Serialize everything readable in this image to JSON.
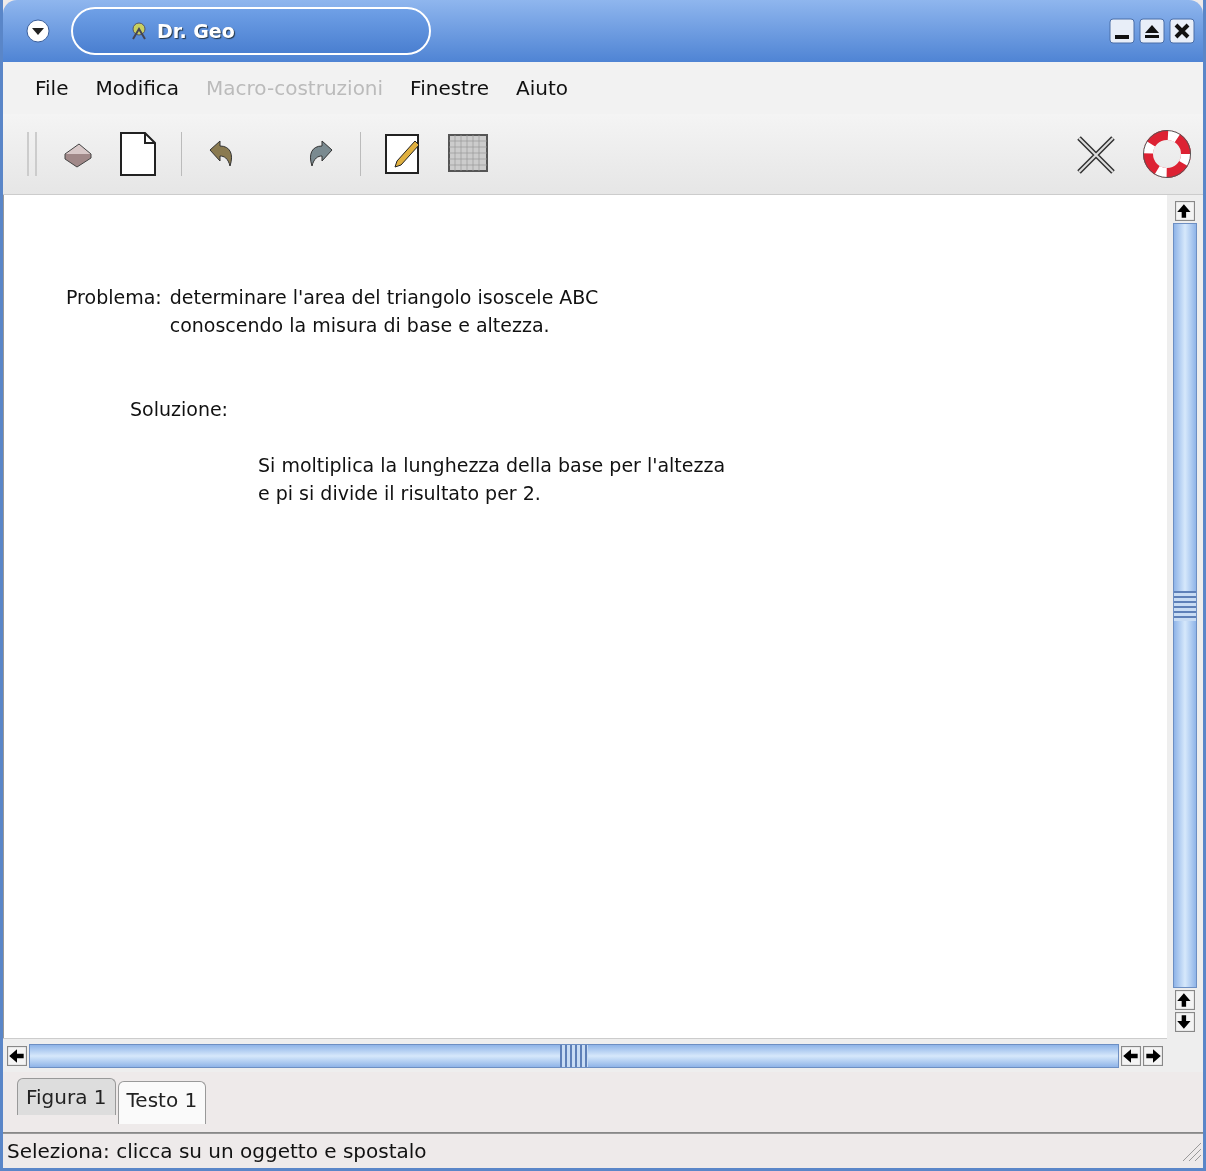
{
  "window": {
    "title": "Dr. Geo"
  },
  "menu": [
    {
      "label": "File",
      "disabled": false
    },
    {
      "label": "Modifica",
      "disabled": false
    },
    {
      "label": "Macro-costruzioni",
      "disabled": true
    },
    {
      "label": "Finestre",
      "disabled": false
    },
    {
      "label": "Aiuto",
      "disabled": false
    }
  ],
  "document": {
    "problem_label": "Problema:",
    "problem_lines": [
      "determinare l'area del triangolo isoscele ABC",
      "conoscendo la misura di base e altezza."
    ],
    "solution_label": "Soluzione:",
    "solution_lines": [
      "Si moltiplica la lunghezza della base per l'altezza",
      "e pi si divide il risultato per 2."
    ]
  },
  "tabs": [
    {
      "label": "Figura 1",
      "selected": false
    },
    {
      "label": "Testo 1",
      "selected": true
    }
  ],
  "status_bar": "Seleziona: clicca su un oggetto e spostalo"
}
